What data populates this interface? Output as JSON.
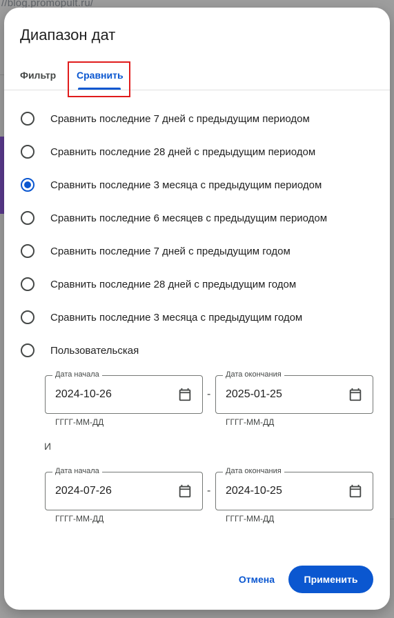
{
  "background": {
    "url_text": "//blog.promopult.ru/"
  },
  "dialog": {
    "title": "Диапазон дат",
    "tabs": [
      {
        "label": "Фильтр",
        "active": false
      },
      {
        "label": "Сравнить",
        "active": true
      }
    ],
    "options": [
      {
        "label": "Сравнить последние 7 дней с предыдущим периодом",
        "checked": false
      },
      {
        "label": "Сравнить последние 28 дней с предыдущим периодом",
        "checked": false
      },
      {
        "label": "Сравнить последние 3 месяца с предыдущим периодом",
        "checked": true
      },
      {
        "label": "Сравнить последние 6 месяцев с предыдущим периодом",
        "checked": false
      },
      {
        "label": "Сравнить последние 7 дней с предыдущим годом",
        "checked": false
      },
      {
        "label": "Сравнить последние 28 дней с предыдущим годом",
        "checked": false
      },
      {
        "label": "Сравнить последние 3 месяца с предыдущим годом",
        "checked": false
      },
      {
        "label": "Пользовательская",
        "checked": false
      }
    ],
    "range1": {
      "start_label": "Дата начала",
      "start_value": "2024-10-26",
      "end_label": "Дата окончания",
      "end_value": "2025-01-25",
      "hint": "ГГГГ-ММ-ДД",
      "separator": "-"
    },
    "and_label": "И",
    "range2": {
      "start_label": "Дата начала",
      "start_value": "2024-07-26",
      "end_label": "Дата окончания",
      "end_value": "2024-10-25",
      "hint": "ГГГГ-ММ-ДД",
      "separator": "-"
    },
    "cancel_label": "Отмена",
    "apply_label": "Применить"
  },
  "colors": {
    "accent": "#0b57d0",
    "highlight": "#e01b1b"
  },
  "icons": {
    "date_picker": "calendar-icon"
  }
}
